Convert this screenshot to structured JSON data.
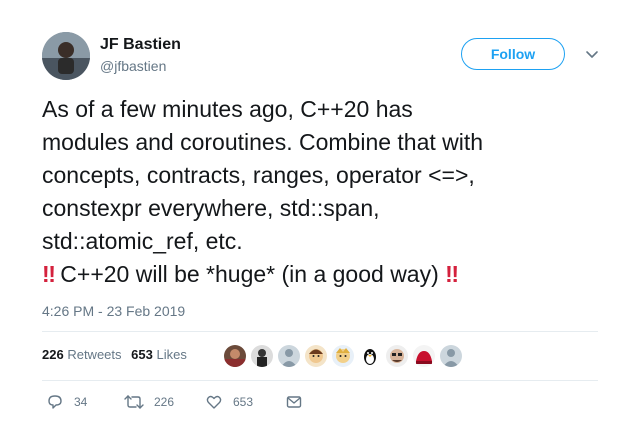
{
  "author": {
    "name": "JF Bastien",
    "handle": "@jfbastien"
  },
  "header": {
    "follow_label": "Follow",
    "caret_icon": "chevron-down-icon"
  },
  "tweet": {
    "lines": [
      "As of a few minutes ago, C++20 has",
      "modules and coroutines. Combine that with",
      "concepts, contracts, ranges, operator <=>,",
      "constexpr everywhere, std::span,",
      "std::atomic_ref, etc."
    ],
    "emphasis_emoji": "‼",
    "emphasis_text": " C++20 will be *huge* (in a good way) "
  },
  "timestamp": "4:26 PM - 23 Feb 2019",
  "stats": {
    "retweets_count": "226",
    "retweets_label": "Retweets",
    "likes_count": "653",
    "likes_label": "Likes"
  },
  "actions": {
    "reply_count": "34",
    "retweet_count": "226",
    "like_count": "653"
  },
  "colors": {
    "accent": "#1da1f2",
    "text": "#14171a",
    "muted": "#657786",
    "emoji_red": "#d4213d"
  }
}
